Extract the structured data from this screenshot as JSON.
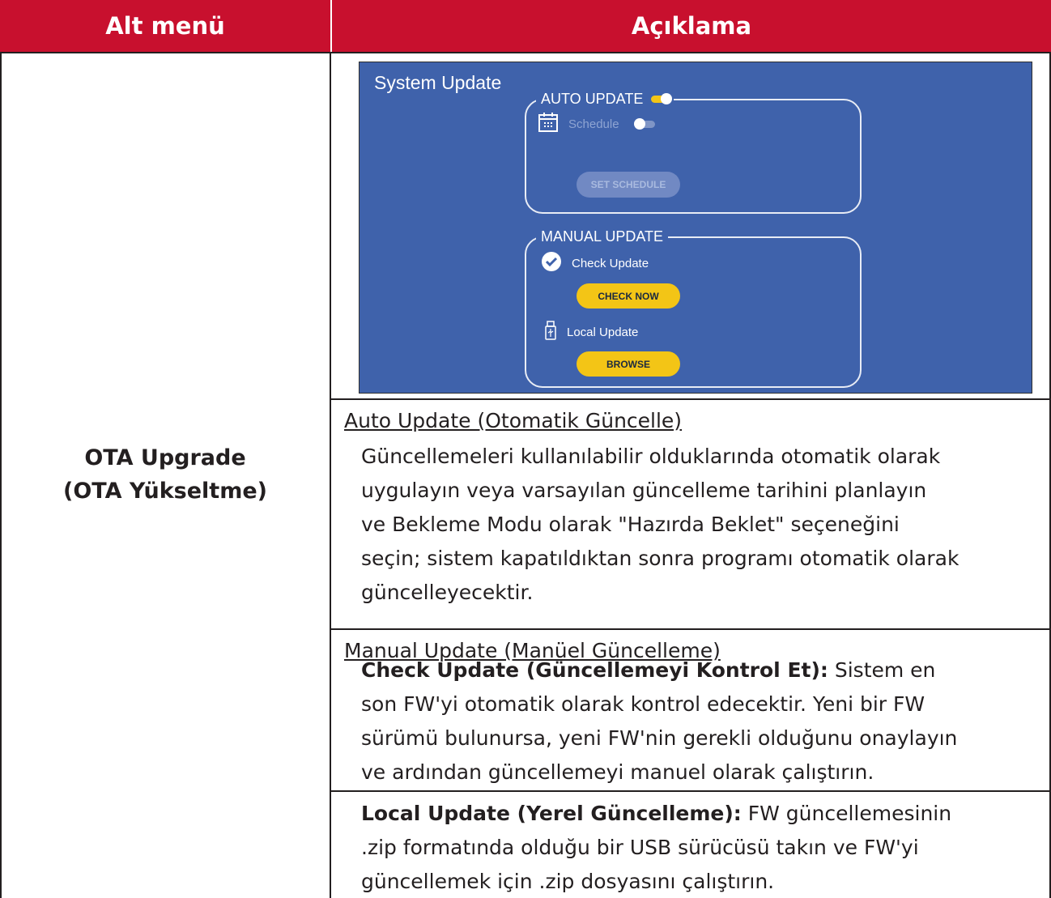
{
  "table": {
    "header_left": "Alt menü",
    "header_right": "Açıklama",
    "submenu_line1": "OTA Upgrade",
    "submenu_line2": "(OTA Yükseltme)"
  },
  "screen": {
    "title": "System Update",
    "auto_update_label": "AUTO UPDATE",
    "auto_update_toggle": "on",
    "schedule_label": "Schedule",
    "schedule_toggle": "off",
    "set_schedule_button": "SET SCHEDULE",
    "manual_update_label": "MANUAL UPDATE",
    "check_update_label": "Check Update",
    "check_now_button": "CHECK NOW",
    "local_update_label": "Local Update",
    "browse_button": "BROWSE",
    "icons": [
      "calendar-icon",
      "check-circle-icon",
      "usb-icon"
    ],
    "colors": {
      "panel": "#3f62ab",
      "accent": "#f3c516",
      "header": "#c8102e"
    }
  },
  "description": {
    "auto_heading": "Auto Update (Otomatik Güncelle)",
    "auto_lines": [
      "Güncellemeleri kullanılabilir olduklarında otomatik olarak",
      "uygulayın veya varsayılan güncelleme tarihini planlayın",
      "ve Bekleme Modu olarak \"Hazırda Beklet\" seçeneğini",
      "seçin; sistem kapatıldıktan sonra programı otomatik olarak",
      "güncelleyecektir."
    ],
    "manual_heading": "Manual Update (Manüel Güncelleme)",
    "check_bold": "Check Update (Güncellemeyi Kontrol Et):",
    "check_line1_rest": " Sistem en",
    "check_lines": [
      "son FW'yi otomatik olarak kontrol edecektir. Yeni bir FW",
      "sürümü bulunursa, yeni FW'nin gerekli olduğunu onaylayın",
      "ve ardından güncellemeyi manuel olarak çalıştırın."
    ],
    "local_bold": "Local Update (Yerel Güncelleme):",
    "local_line1_rest": " FW güncellemesinin",
    "local_lines": [
      ".zip formatında olduğu bir USB sürücüsü takın ve FW'yi",
      "güncellemek için .zip dosyasını çalıştırın."
    ]
  }
}
